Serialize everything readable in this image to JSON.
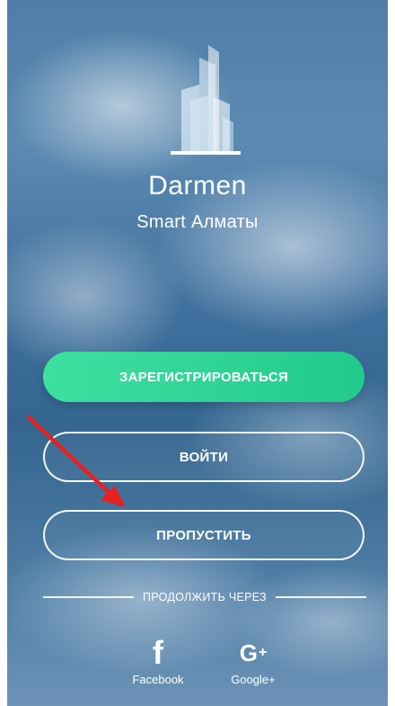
{
  "app": {
    "title": "Darmen",
    "subtitle": "Smart Алматы"
  },
  "buttons": {
    "register_label": "ЗАРЕГИСТРИРОВАТЬСЯ",
    "login_label": "ВОЙТИ",
    "skip_label": "ПРОПУСТИТЬ"
  },
  "divider": {
    "label": "ПРОДОЛЖИТЬ ЧЕРЕЗ"
  },
  "social": [
    {
      "icon": "facebook-icon",
      "glyph": "f",
      "label": "Facebook"
    },
    {
      "icon": "google-plus-icon",
      "glyph": "G",
      "label": "Google+"
    }
  ],
  "colors": {
    "register_button": "#2fd597",
    "annotation_arrow": "#e8201e",
    "text": "#ffffff"
  }
}
